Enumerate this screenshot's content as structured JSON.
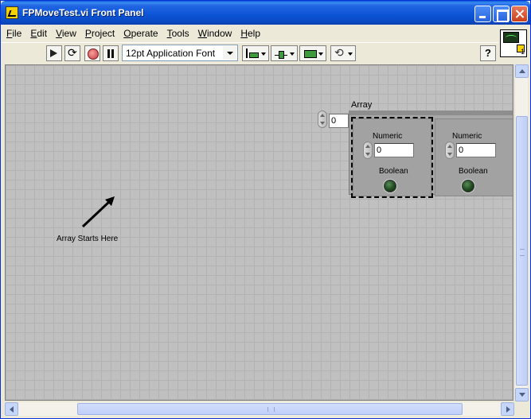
{
  "window": {
    "title": "FPMoveTest.vi Front Panel",
    "icon": "labview-vi-icon"
  },
  "menu": {
    "items": [
      {
        "u": "F",
        "rest": "ile"
      },
      {
        "u": "E",
        "rest": "dit"
      },
      {
        "u": "V",
        "rest": "iew"
      },
      {
        "u": "P",
        "rest": "roject"
      },
      {
        "u": "O",
        "rest": "perate"
      },
      {
        "u": "T",
        "rest": "ools"
      },
      {
        "u": "W",
        "rest": "indow"
      },
      {
        "u": "H",
        "rest": "elp"
      }
    ]
  },
  "toolbar": {
    "font_value": "12pt Application Font",
    "help_label": "?",
    "icons": {
      "run": "run-arrow-icon",
      "run_continuously": "run-continuously-icon",
      "abort": "abort-stop-icon",
      "pause": "pause-icon",
      "align": "align-objects-icon",
      "distribute": "distribute-objects-icon",
      "resize": "resize-objects-icon",
      "reorder": "reorder-icon"
    }
  },
  "vi_icon": {
    "connector_number": "1"
  },
  "panel": {
    "array": {
      "label": "Array",
      "index_value": "0",
      "elements": [
        {
          "numeric_label": "Numeric",
          "numeric_value": "0",
          "boolean_label": "Boolean",
          "boolean_state": false
        },
        {
          "numeric_label": "Numeric",
          "numeric_value": "0",
          "boolean_label": "Boolean",
          "boolean_state": false
        }
      ]
    },
    "free_label": "Array Starts Here"
  },
  "colors": {
    "title_bar": "#0a54d6",
    "canvas": "#c0c0c0",
    "led_off": "#1e4a1e"
  }
}
